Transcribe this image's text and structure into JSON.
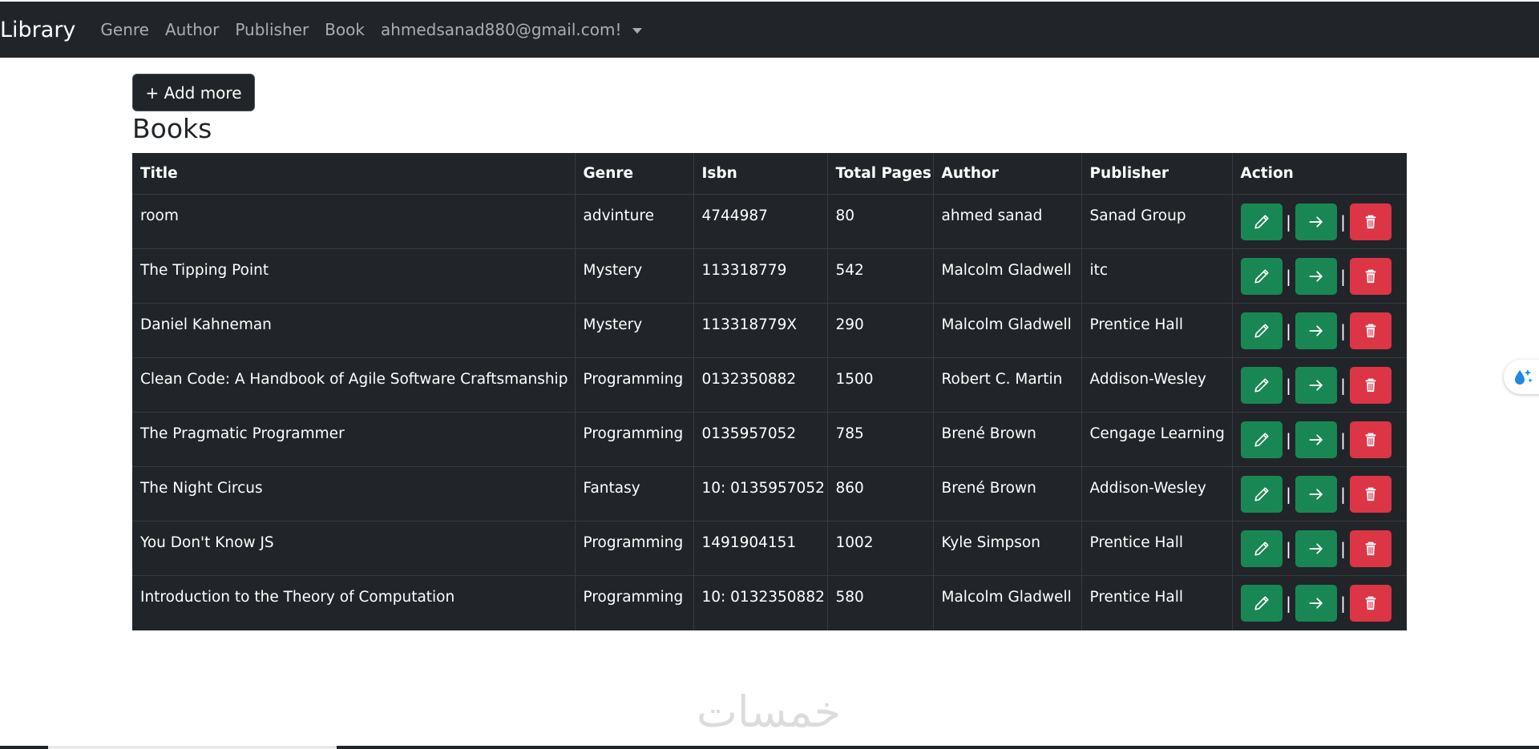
{
  "navbar": {
    "brand": "Library",
    "links": [
      "Genre",
      "Author",
      "Publisher",
      "Book"
    ],
    "user": "ahmedsanad880@gmail.com!"
  },
  "add_button": "+ Add more",
  "heading": "Books",
  "table": {
    "headers": [
      "Title",
      "Genre",
      "Isbn",
      "Total Pages",
      "Author",
      "Publisher",
      "Action"
    ],
    "rows": [
      [
        "room",
        "advinture",
        "4744987",
        "80",
        "ahmed sanad",
        "Sanad Group"
      ],
      [
        "The Tipping Point",
        "Mystery",
        "113318779",
        "542",
        "Malcolm Gladwell",
        "itc"
      ],
      [
        "Daniel Kahneman",
        "Mystery",
        "113318779X",
        "290",
        "Malcolm Gladwell",
        "Prentice Hall"
      ],
      [
        "Clean Code: A Handbook of Agile Software Craftsmanship",
        "Programming",
        "0132350882",
        "1500",
        "Robert C. Martin",
        "Addison-Wesley"
      ],
      [
        "The Pragmatic Programmer",
        "Programming",
        "0135957052",
        "785",
        "Brené Brown",
        "Cengage Learning"
      ],
      [
        "The Night Circus",
        "Fantasy",
        "10: 0135957052",
        "860",
        "Brené Brown",
        "Addison-Wesley"
      ],
      [
        "You Don't Know JS",
        "Programming",
        "1491904151",
        "1002",
        "Kyle Simpson",
        "Prentice Hall"
      ],
      [
        "Introduction to the Theory of Computation",
        "Programming",
        "10: 0132350882",
        "580",
        "Malcolm Gladwell",
        "Prentice Hall"
      ]
    ],
    "action_separator": "|"
  },
  "icons": {
    "edit": "pencil-icon",
    "view": "arrow-right-icon",
    "delete": "trash-icon",
    "assistant": "droplet-sparkle-icon"
  },
  "watermark": "خمسات",
  "colors": {
    "navbar": "#212529",
    "table": "#212529",
    "success": "#198754",
    "danger": "#dc3545"
  }
}
